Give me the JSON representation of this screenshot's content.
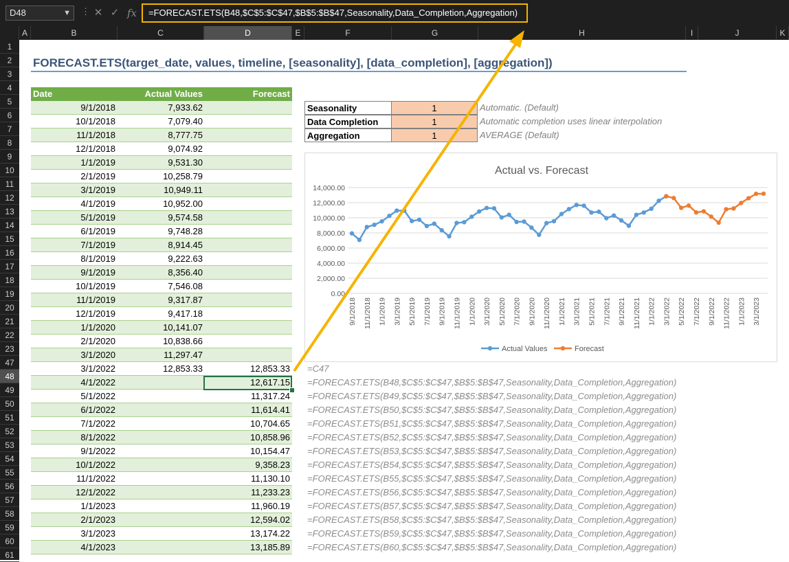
{
  "formula_bar": {
    "name_box": "D48",
    "formula": "=FORECAST.ETS(B48,$C$5:$C$47,$B$5:$B$47,Seasonality,Data_Completion,Aggregation)",
    "cancel_icon": "x-icon",
    "enter_icon": "check-icon",
    "fx_label": "fx"
  },
  "column_headers": [
    "A",
    "B",
    "C",
    "D",
    "E",
    "F",
    "G",
    "H",
    "I",
    "J",
    "K"
  ],
  "row_numbers": [
    "1",
    "2",
    "3",
    "4",
    "5",
    "6",
    "7",
    "8",
    "9",
    "10",
    "11",
    "12",
    "13",
    "14",
    "15",
    "16",
    "17",
    "18",
    "19",
    "20",
    "21",
    "22",
    "23",
    "47",
    "48",
    "49",
    "50",
    "51",
    "52",
    "53",
    "54",
    "55",
    "56",
    "57",
    "58",
    "59",
    "60",
    "61"
  ],
  "title": "FORECAST.ETS(target_date, values, timeline, [seasonality], [data_completion], [aggregation])",
  "table": {
    "headers": [
      "Date",
      "Actual Values",
      "Forecast"
    ],
    "rows": [
      [
        "9/1/2018",
        "7,933.62",
        ""
      ],
      [
        "10/1/2018",
        "7,079.40",
        ""
      ],
      [
        "11/1/2018",
        "8,777.75",
        ""
      ],
      [
        "12/1/2018",
        "9,074.92",
        ""
      ],
      [
        "1/1/2019",
        "9,531.30",
        ""
      ],
      [
        "2/1/2019",
        "10,258.79",
        ""
      ],
      [
        "3/1/2019",
        "10,949.11",
        ""
      ],
      [
        "4/1/2019",
        "10,952.00",
        ""
      ],
      [
        "5/1/2019",
        "9,574.58",
        ""
      ],
      [
        "6/1/2019",
        "9,748.28",
        ""
      ],
      [
        "7/1/2019",
        "8,914.45",
        ""
      ],
      [
        "8/1/2019",
        "9,222.63",
        ""
      ],
      [
        "9/1/2019",
        "8,356.40",
        ""
      ],
      [
        "10/1/2019",
        "7,546.08",
        ""
      ],
      [
        "11/1/2019",
        "9,317.87",
        ""
      ],
      [
        "12/1/2019",
        "9,417.18",
        ""
      ],
      [
        "1/1/2020",
        "10,141.07",
        ""
      ],
      [
        "2/1/2020",
        "10,838.66",
        ""
      ],
      [
        "3/1/2020",
        "11,297.47",
        ""
      ],
      [
        "3/1/2022",
        "12,853.33",
        "12,853.33"
      ],
      [
        "4/1/2022",
        "",
        "12,617.15"
      ],
      [
        "5/1/2022",
        "",
        "11,317.24"
      ],
      [
        "6/1/2022",
        "",
        "11,614.41"
      ],
      [
        "7/1/2022",
        "",
        "10,704.65"
      ],
      [
        "8/1/2022",
        "",
        "10,858.96"
      ],
      [
        "9/1/2022",
        "",
        "10,154.47"
      ],
      [
        "10/1/2022",
        "",
        "9,358.23"
      ],
      [
        "11/1/2022",
        "",
        "11,130.10"
      ],
      [
        "12/1/2022",
        "",
        "11,233.23"
      ],
      [
        "1/1/2023",
        "",
        "11,960.19"
      ],
      [
        "2/1/2023",
        "",
        "12,594.02"
      ],
      [
        "3/1/2023",
        "",
        "13,174.22"
      ],
      [
        "4/1/2023",
        "",
        "13,185.89"
      ]
    ]
  },
  "params": [
    {
      "label": "Seasonality",
      "value": "1",
      "note": "Automatic. (Default)"
    },
    {
      "label": "Data Completion",
      "value": "1",
      "note": "Automatic completion uses linear interpolation"
    },
    {
      "label": "Aggregation",
      "value": "1",
      "note": "AVERAGE (Default)"
    }
  ],
  "formula_notes": [
    "=C47",
    "=FORECAST.ETS(B48,$C$5:$C$47,$B$5:$B$47,Seasonality,Data_Completion,Aggregation)",
    "=FORECAST.ETS(B49,$C$5:$C$47,$B$5:$B$47,Seasonality,Data_Completion,Aggregation)",
    "=FORECAST.ETS(B50,$C$5:$C$47,$B$5:$B$47,Seasonality,Data_Completion,Aggregation)",
    "=FORECAST.ETS(B51,$C$5:$C$47,$B$5:$B$47,Seasonality,Data_Completion,Aggregation)",
    "=FORECAST.ETS(B52,$C$5:$C$47,$B$5:$B$47,Seasonality,Data_Completion,Aggregation)",
    "=FORECAST.ETS(B53,$C$5:$C$47,$B$5:$B$47,Seasonality,Data_Completion,Aggregation)",
    "=FORECAST.ETS(B54,$C$5:$C$47,$B$5:$B$47,Seasonality,Data_Completion,Aggregation)",
    "=FORECAST.ETS(B55,$C$5:$C$47,$B$5:$B$47,Seasonality,Data_Completion,Aggregation)",
    "=FORECAST.ETS(B56,$C$5:$C$47,$B$5:$B$47,Seasonality,Data_Completion,Aggregation)",
    "=FORECAST.ETS(B57,$C$5:$C$47,$B$5:$B$47,Seasonality,Data_Completion,Aggregation)",
    "=FORECAST.ETS(B58,$C$5:$C$47,$B$5:$B$47,Seasonality,Data_Completion,Aggregation)",
    "=FORECAST.ETS(B59,$C$5:$C$47,$B$5:$B$47,Seasonality,Data_Completion,Aggregation)",
    "=FORECAST.ETS(B60,$C$5:$C$47,$B$5:$B$47,Seasonality,Data_Completion,Aggregation)"
  ],
  "colors": {
    "actual": "#5b9bd5",
    "forecast": "#ed7d31",
    "header_green": "#70ad47",
    "band_green": "#e2efda",
    "param_orange": "#f8cbad",
    "highlight": "#f5b400"
  },
  "chart_data": {
    "type": "line",
    "title": "Actual vs. Forecast",
    "xlabel": "",
    "ylabel": "",
    "ylim": [
      0,
      14000
    ],
    "yticks": [
      "0.00",
      "2,000.00",
      "4,000.00",
      "6,000.00",
      "8,000.00",
      "10,000.00",
      "12,000.00",
      "14,000.00"
    ],
    "x": [
      "9/1/2018",
      "10/1/2018",
      "11/1/2018",
      "12/1/2018",
      "1/1/2019",
      "2/1/2019",
      "3/1/2019",
      "4/1/2019",
      "5/1/2019",
      "6/1/2019",
      "7/1/2019",
      "8/1/2019",
      "9/1/2019",
      "10/1/2019",
      "11/1/2019",
      "12/1/2019",
      "1/1/2020",
      "2/1/2020",
      "3/1/2020",
      "4/1/2020",
      "5/1/2020",
      "6/1/2020",
      "7/1/2020",
      "8/1/2020",
      "9/1/2020",
      "10/1/2020",
      "11/1/2020",
      "12/1/2020",
      "1/1/2021",
      "2/1/2021",
      "3/1/2021",
      "4/1/2021",
      "5/1/2021",
      "6/1/2021",
      "7/1/2021",
      "8/1/2021",
      "9/1/2021",
      "10/1/2021",
      "11/1/2021",
      "12/1/2021",
      "1/1/2022",
      "2/1/2022",
      "3/1/2022",
      "4/1/2022",
      "5/1/2022",
      "6/1/2022",
      "7/1/2022",
      "8/1/2022",
      "9/1/2022",
      "10/1/2022",
      "11/1/2022",
      "12/1/2022",
      "1/1/2023",
      "2/1/2023",
      "3/1/2023",
      "4/1/2023"
    ],
    "xtick_labels": [
      "9/1/2018",
      "11/1/2018",
      "1/1/2019",
      "3/1/2019",
      "5/1/2019",
      "7/1/2019",
      "9/1/2019",
      "11/1/2019",
      "1/1/2020",
      "3/1/2020",
      "5/1/2020",
      "7/1/2020",
      "9/1/2020",
      "11/1/2020",
      "1/1/2021",
      "3/1/2021",
      "5/1/2021",
      "7/1/2021",
      "9/1/2021",
      "11/1/2021",
      "1/1/2022",
      "3/1/2022",
      "5/1/2022",
      "7/1/2022",
      "9/1/2022",
      "11/1/2022",
      "1/1/2023",
      "3/1/2023"
    ],
    "series": [
      {
        "name": "Actual Values",
        "values": [
          7933.62,
          7079.4,
          8777.75,
          9074.92,
          9531.3,
          10258.79,
          10949.11,
          10952.0,
          9574.58,
          9748.28,
          8914.45,
          9222.63,
          8356.4,
          7546.08,
          9317.87,
          9417.18,
          10141.07,
          10838.66,
          11297.47,
          11250,
          10050,
          10400,
          9450,
          9500,
          8700,
          7750,
          9300,
          9550,
          10500,
          11150,
          11700,
          11600,
          10700,
          10800,
          9950,
          10300,
          9650,
          8950,
          10400,
          10700,
          11200,
          12250,
          12853.33,
          null,
          null,
          null,
          null,
          null,
          null,
          null,
          null,
          null,
          null,
          null,
          null,
          null
        ]
      },
      {
        "name": "Forecast",
        "values": [
          null,
          null,
          null,
          null,
          null,
          null,
          null,
          null,
          null,
          null,
          null,
          null,
          null,
          null,
          null,
          null,
          null,
          null,
          null,
          null,
          null,
          null,
          null,
          null,
          null,
          null,
          null,
          null,
          null,
          null,
          null,
          null,
          null,
          null,
          null,
          null,
          null,
          null,
          null,
          null,
          null,
          null,
          12853.33,
          12617.15,
          11317.24,
          11614.41,
          10704.65,
          10858.96,
          10154.47,
          9358.23,
          11130.1,
          11233.23,
          11960.19,
          12594.02,
          13174.22,
          13185.89
        ]
      }
    ],
    "grid": true,
    "legend": "bottom"
  }
}
